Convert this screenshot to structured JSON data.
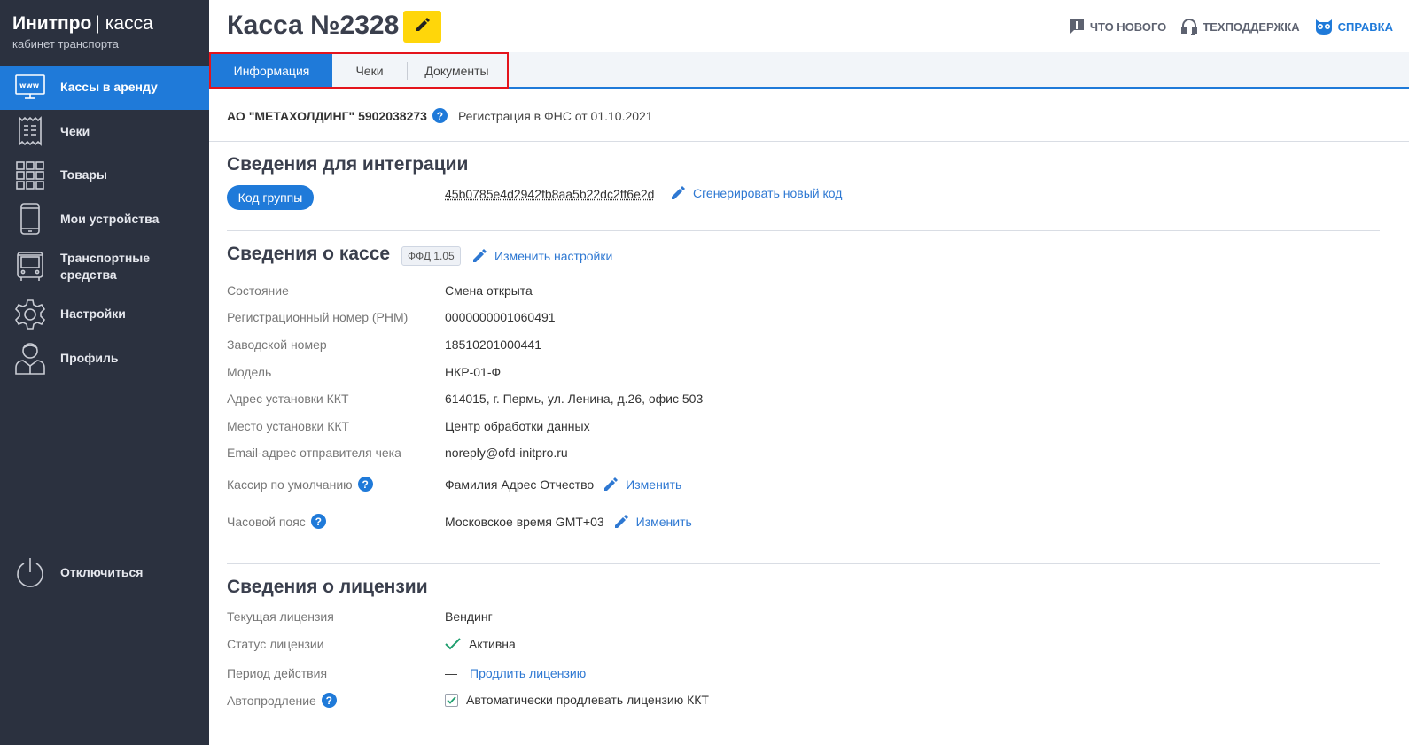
{
  "logo": {
    "brand": "Инитпро",
    "separator": "|",
    "product": "касса",
    "subtitle": "кабинет транспорта"
  },
  "sidebar": {
    "items": [
      {
        "label": "Кассы в аренду",
        "icon": "monitor-www-icon",
        "active": true
      },
      {
        "label": "Чеки",
        "icon": "receipt-icon"
      },
      {
        "label": "Товары",
        "icon": "grid-icon"
      },
      {
        "label": "Мои устройства",
        "icon": "smartphone-icon"
      },
      {
        "label": "Транспортные средства",
        "icon": "bus-icon"
      },
      {
        "label": "Настройки",
        "icon": "gear-icon"
      },
      {
        "label": "Профиль",
        "icon": "user-icon"
      }
    ],
    "logout": {
      "label": "Отключиться",
      "icon": "power-icon"
    }
  },
  "header": {
    "title": "Касса №2328",
    "links": {
      "whats_new": "ЧТО НОВОГО",
      "support": "ТЕХПОДДЕРЖКА",
      "help": "СПРАВКА"
    }
  },
  "tabs": {
    "info": "Информация",
    "receipts": "Чеки",
    "documents": "Документы"
  },
  "org": {
    "name": "АО \"МЕТАХОЛДИНГ\" 5902038273",
    "registration": "Регистрация в ФНС от 01.10.2021"
  },
  "integration": {
    "title": "Сведения для интеграции",
    "group_button": "Код группы",
    "code": "45b0785e4d2942fb8aa5b22dc2ff6e2d",
    "regenerate": "Сгенерировать новый код"
  },
  "kkt": {
    "title": "Сведения о кассе",
    "ffd": "ФФД 1.05",
    "change_settings": "Изменить настройки",
    "rows": [
      {
        "label": "Состояние",
        "value": "Смена открыта"
      },
      {
        "label": "Регистрационный номер (РНМ)",
        "value": "0000000001060491"
      },
      {
        "label": "Заводской номер",
        "value": "18510201000441"
      },
      {
        "label": "Модель",
        "value": "НКР-01-Ф"
      },
      {
        "label": "Адрес установки ККТ",
        "value": "614015, г. Пермь, ул. Ленина, д.26, офис 503"
      },
      {
        "label": "Место установки ККТ",
        "value": "Центр обработки данных"
      },
      {
        "label": "Email-адрес отправителя чека",
        "value": "noreply@ofd-initpro.ru"
      }
    ],
    "cashier": {
      "label": "Кассир по умолчанию",
      "value": "Фамилия Адрес Отчество",
      "action": "Изменить"
    },
    "timezone": {
      "label": "Часовой пояс",
      "value": "Московское время GMT+03",
      "action": "Изменить"
    }
  },
  "license": {
    "title": "Сведения о лицензии",
    "current_label": "Текущая лицензия",
    "current_value": "Вендинг",
    "status_label": "Статус лицензии",
    "status_value": "Активна",
    "period_label": "Период действия",
    "period_value": "—",
    "extend": "Продлить лицензию",
    "autorenew_label": "Автопродление",
    "autorenew_value": "Автоматически продлевать лицензию ККТ",
    "autorenew_checked": true
  },
  "colors": {
    "accent": "#1f7ad9",
    "sidebar": "#2b313f",
    "edit_button": "#ffd60a",
    "highlight_frame": "#e4141c"
  }
}
